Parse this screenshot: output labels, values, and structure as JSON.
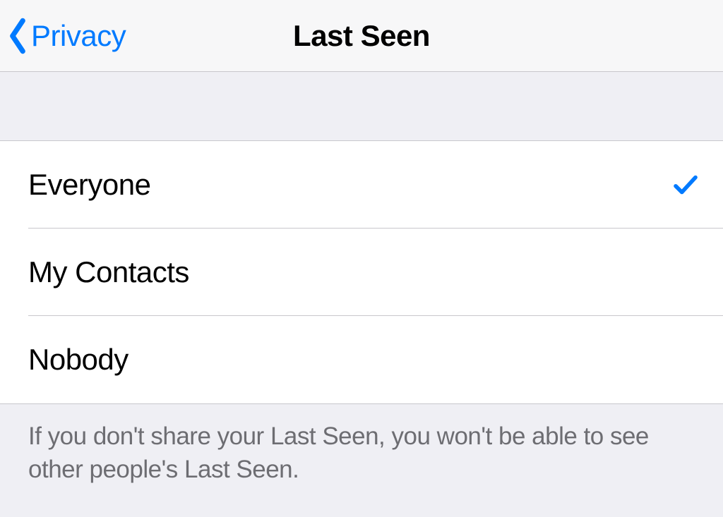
{
  "nav": {
    "back_label": "Privacy",
    "title": "Last Seen"
  },
  "options": {
    "0": {
      "label": "Everyone",
      "selected": true
    },
    "1": {
      "label": "My Contacts",
      "selected": false
    },
    "2": {
      "label": "Nobody",
      "selected": false
    }
  },
  "footer": {
    "text": "If you don't share your Last Seen, you won't be able to see other people's Last Seen."
  },
  "colors": {
    "accent": "#007aff"
  }
}
